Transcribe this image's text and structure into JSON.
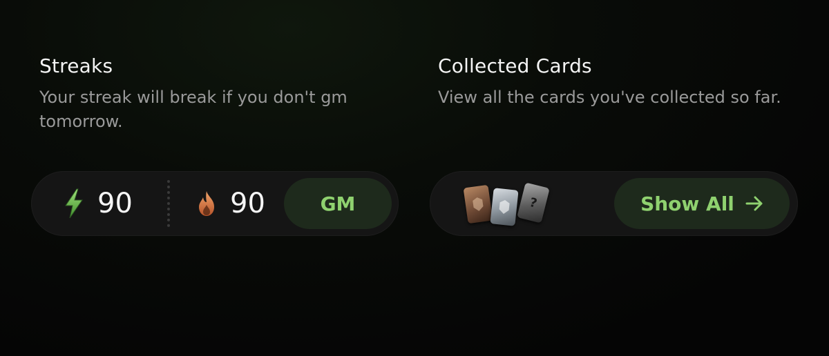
{
  "streaks": {
    "title": "Streaks",
    "description": "Your streak will break if you don't gm tomorrow.",
    "bolt_icon": "lightning-bolt-icon",
    "bolt_value": "90",
    "flame_icon": "flame-icon",
    "flame_value": "90",
    "gm_label": "GM"
  },
  "collected_cards": {
    "title": "Collected Cards",
    "description": "View all the cards you've collected so far.",
    "cards": [
      {
        "icon": "bronze-card-icon"
      },
      {
        "icon": "silver-card-icon"
      },
      {
        "icon": "mystery-card-icon",
        "glyph": "?"
      }
    ],
    "show_all_label": "Show All",
    "arrow_icon": "arrow-right-icon"
  },
  "colors": {
    "accent": "#8fd16f",
    "button_bg": "#1e2a1c",
    "pill_bg": "#151515",
    "muted_text": "#9a9a9a"
  }
}
